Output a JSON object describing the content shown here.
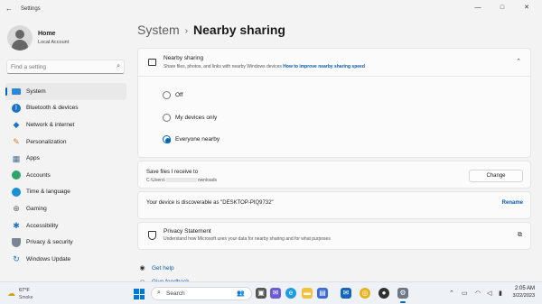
{
  "window": {
    "title": "Settings",
    "back_glyph": "←",
    "minimize_glyph": "—",
    "maximize_glyph": "□",
    "close_glyph": "✕"
  },
  "profile": {
    "name": "Home",
    "account_type": "Local Account"
  },
  "search": {
    "placeholder": "Find a setting",
    "icon": "search-icon"
  },
  "sidebar": {
    "items": [
      {
        "label": "System",
        "icon": "system-icon",
        "active": true
      },
      {
        "label": "Bluetooth & devices",
        "icon": "bluetooth-icon"
      },
      {
        "label": "Network & internet",
        "icon": "network-icon"
      },
      {
        "label": "Personalization",
        "icon": "brush-icon"
      },
      {
        "label": "Apps",
        "icon": "apps-icon"
      },
      {
        "label": "Accounts",
        "icon": "accounts-icon"
      },
      {
        "label": "Time & language",
        "icon": "globe-icon"
      },
      {
        "label": "Gaming",
        "icon": "gaming-icon"
      },
      {
        "label": "Accessibility",
        "icon": "accessibility-icon"
      },
      {
        "label": "Privacy & security",
        "icon": "shield-icon"
      },
      {
        "label": "Windows Update",
        "icon": "update-icon"
      }
    ]
  },
  "breadcrumb": {
    "parent": "System",
    "separator": "›",
    "current": "Nearby sharing"
  },
  "nearby": {
    "title": "Nearby sharing",
    "description": "Share files, photos, and links with nearby Windows devices",
    "link": "How to improve nearby sharing speed",
    "options": [
      {
        "label": "Off",
        "checked": false
      },
      {
        "label": "My devices only",
        "checked": false
      },
      {
        "label": "Everyone nearby",
        "checked": true
      }
    ]
  },
  "save_files": {
    "title": "Save files I receive to",
    "path_prefix": "C:\\Users\\",
    "path_suffix": "ownloads",
    "button": "Change"
  },
  "discoverable": {
    "text": "Your device is discoverable as \"DESKTOP-PIQ9732\"",
    "action": "Rename"
  },
  "privacy": {
    "title": "Privacy Statement",
    "description": "Understand how Microsoft uses your data for nearby sharing and for what purposes"
  },
  "help_links": [
    {
      "label": "Get help",
      "icon": "help-icon"
    },
    {
      "label": "Give feedback",
      "icon": "feedback-icon"
    }
  ],
  "taskbar": {
    "weather_temp": "67°F",
    "weather_condition": "Smoke",
    "search_label": "Search",
    "time": "2:05 AM",
    "date": "3/22/2023",
    "accent": "#0067c0"
  }
}
